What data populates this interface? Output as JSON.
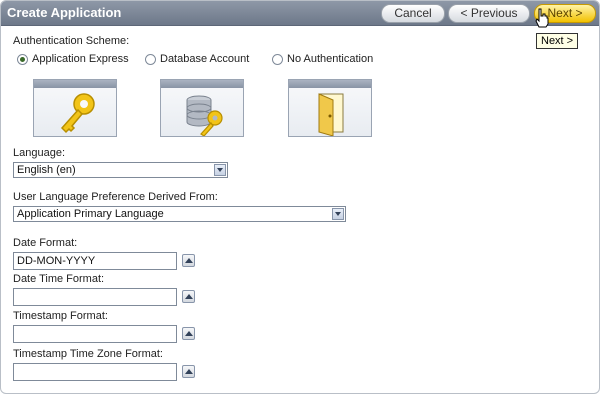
{
  "window": {
    "title": "Create Application"
  },
  "toolbar": {
    "cancel_label": "Cancel",
    "previous_label": "< Previous",
    "next_label": "Next >",
    "next_tooltip": "Next >"
  },
  "auth": {
    "label": "Authentication Scheme:",
    "options": [
      {
        "label": "Application Express",
        "selected": true,
        "icon": "key-icon"
      },
      {
        "label": "Database Account",
        "selected": false,
        "icon": "database-key-icon"
      },
      {
        "label": "No Authentication",
        "selected": false,
        "icon": "open-door-icon"
      }
    ]
  },
  "language": {
    "label": "Language:",
    "value": "English (en)"
  },
  "pref": {
    "label": "User Language Preference Derived From:",
    "value": "Application Primary Language"
  },
  "date_format": {
    "label": "Date Format:",
    "value": "DD-MON-YYYY"
  },
  "date_time_format": {
    "label": "Date Time Format:",
    "value": ""
  },
  "timestamp_format": {
    "label": "Timestamp Format:",
    "value": ""
  },
  "timestamp_tz_format": {
    "label": "Timestamp Time Zone Format:",
    "value": ""
  }
}
